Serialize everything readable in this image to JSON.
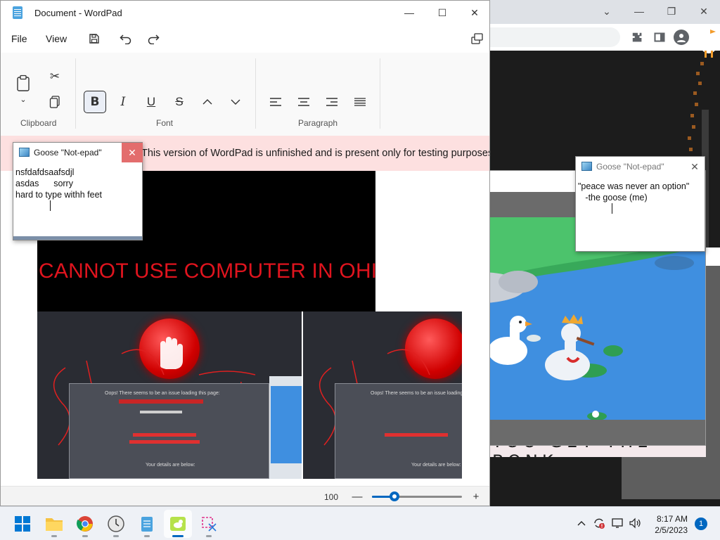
{
  "browser": {
    "caption_buttons": [
      "chevron-down",
      "minimize",
      "restore",
      "close"
    ],
    "toolbar_icons": [
      "extensions",
      "sidebar",
      "profile"
    ]
  },
  "wordpad": {
    "title": "Document - WordPad",
    "menu": {
      "file": "File",
      "view": "View"
    },
    "ribbon": {
      "clipboard_label": "Clipboard",
      "font_label": "Font",
      "paragraph_label": "Paragraph",
      "font_buttons": {
        "bold": "B",
        "italic": "I",
        "underline": "U",
        "strikethrough": "S"
      }
    },
    "warning": "This version of WordPad is unfinished and is present only for testing purposes.",
    "document": {
      "banner_text": "CANNOT USE COMPUTER IN OHIO",
      "error_lines": [
        "Oops! There seems to be an issue loading this page:",
        "Your details are below:"
      ]
    },
    "status": {
      "zoom": "100",
      "zoom_percent": 25
    }
  },
  "goose_pad_1": {
    "title": "Goose \"Not-epad\"",
    "text": "nsfdafdsaafsdjl\nasdas      sorry\nhard to type withh feet"
  },
  "goose_pad_2": {
    "title": "Goose \"Not-epad\"",
    "text": "\"peace was never an option\"\n   -the goose (me)"
  },
  "screenshot_caption": "YOU GET THE BONK",
  "taskbar": {
    "apps": [
      "windows-start",
      "file-explorer",
      "chrome",
      "clock-app",
      "wordpad",
      "desktop-goose",
      "snipping-tool"
    ],
    "time": "8:17 AM",
    "date": "2/5/2023",
    "notifications": "1"
  },
  "colors": {
    "accent": "#0067c0",
    "warning_bg": "#fde0e0",
    "ohio_red": "#e0141e",
    "water": "#3f8fe0"
  }
}
